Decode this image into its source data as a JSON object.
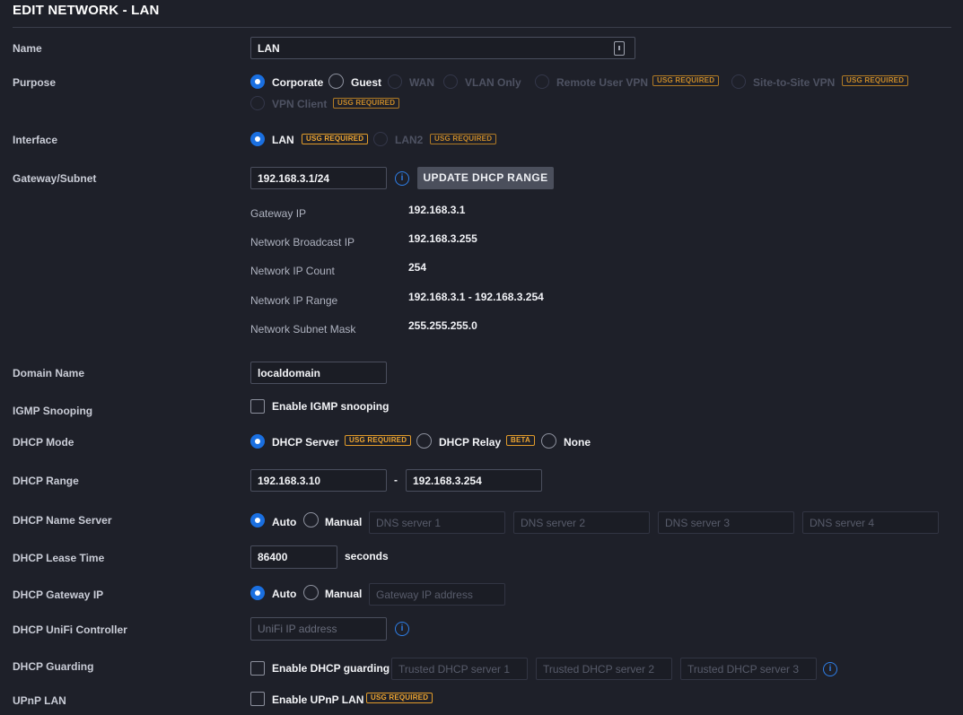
{
  "title": "EDIT NETWORK - LAN",
  "labels": {
    "name": "Name",
    "purpose": "Purpose",
    "interface": "Interface",
    "gateway_subnet": "Gateway/Subnet",
    "domain_name": "Domain Name",
    "igmp": "IGMP Snooping",
    "dhcp_mode": "DHCP Mode",
    "dhcp_range": "DHCP Range",
    "dhcp_name_server": "DHCP Name Server",
    "dhcp_lease_time": "DHCP Lease Time",
    "dhcp_gateway_ip": "DHCP Gateway IP",
    "dhcp_unifi_controller": "DHCP UniFi Controller",
    "dhcp_guarding": "DHCP Guarding",
    "upnp_lan": "UPnP LAN"
  },
  "name_value": "LAN",
  "purpose": {
    "options": [
      "Corporate",
      "Guest",
      "WAN",
      "VLAN Only",
      "Remote User VPN",
      "Site-to-Site VPN",
      "VPN Client"
    ],
    "selected": "Corporate",
    "badge": "USG REQUIRED"
  },
  "interface": {
    "options": [
      "LAN",
      "LAN2"
    ],
    "selected": "LAN",
    "badge": "USG REQUIRED"
  },
  "gateway": {
    "value": "192.168.3.1/24",
    "info": "i",
    "button": "UPDATE DHCP RANGE",
    "details": [
      {
        "label": "Gateway IP",
        "value": "192.168.3.1"
      },
      {
        "label": "Network Broadcast IP",
        "value": "192.168.3.255"
      },
      {
        "label": "Network IP Count",
        "value": "254"
      },
      {
        "label": "Network IP Range",
        "value": "192.168.3.1 - 192.168.3.254"
      },
      {
        "label": "Network Subnet Mask",
        "value": "255.255.255.0"
      }
    ]
  },
  "domain_name_value": "localdomain",
  "igmp_checkbox_label": "Enable IGMP snooping",
  "dhcp_mode": {
    "options": [
      "DHCP Server",
      "DHCP Relay",
      "None"
    ],
    "selected": "DHCP Server",
    "server_badge": "USG REQUIRED",
    "relay_badge": "BETA"
  },
  "dhcp_range": {
    "start": "192.168.3.10",
    "separator": "-",
    "end": "192.168.3.254"
  },
  "name_server": {
    "options": [
      "Auto",
      "Manual"
    ],
    "selected": "Auto",
    "placeholders": [
      "DNS server 1",
      "DNS server 2",
      "DNS server 3",
      "DNS server 4"
    ]
  },
  "lease": {
    "value": "86400",
    "unit": "seconds"
  },
  "gateway_ip": {
    "options": [
      "Auto",
      "Manual"
    ],
    "selected": "Auto",
    "placeholder": "Gateway IP address"
  },
  "unifi_controller": {
    "placeholder": "UniFi IP address",
    "info": "i"
  },
  "guarding": {
    "checkbox_label": "Enable DHCP guarding",
    "placeholders": [
      "Trusted DHCP server 1",
      "Trusted DHCP server 2",
      "Trusted DHCP server 3"
    ],
    "info": "i"
  },
  "upnp": {
    "checkbox_label": "Enable UPnP LAN",
    "badge": "USG REQUIRED"
  },
  "colors": {
    "background": "#1e2029",
    "accent": "#1a6fe0",
    "badge": "#f0a630",
    "info": "#2f7fe8"
  },
  "icons": {
    "name_field": "lock-icon",
    "info": "info-icon"
  }
}
